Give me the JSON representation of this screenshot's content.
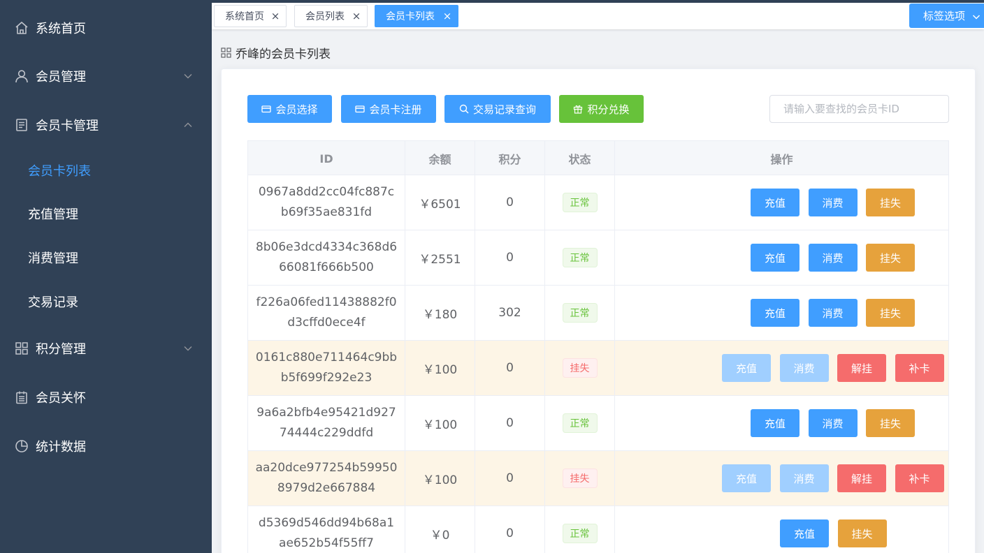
{
  "sidebar": {
    "items": [
      {
        "label": "系统首页",
        "icon": "home-icon"
      },
      {
        "label": "会员管理",
        "icon": "user-icon"
      },
      {
        "label": "会员卡管理",
        "icon": "document-icon"
      },
      {
        "label": "积分管理",
        "icon": "grid-icon"
      },
      {
        "label": "会员关怀",
        "icon": "calendar-icon"
      },
      {
        "label": "统计数据",
        "icon": "pie-chart-icon"
      }
    ],
    "submenu": [
      {
        "label": "会员卡列表",
        "active": true
      },
      {
        "label": "充值管理"
      },
      {
        "label": "消费管理"
      },
      {
        "label": "交易记录"
      }
    ]
  },
  "tags": [
    {
      "label": "系统首页"
    },
    {
      "label": "会员列表"
    },
    {
      "label": "会员卡列表",
      "active": true
    }
  ],
  "tag_options_label": "标签选项",
  "page_title": "乔峰的会员卡列表",
  "toolbar": {
    "select_member": "会员选择",
    "register_card": "会员卡注册",
    "query_transactions": "交易记录查询",
    "points_exchange": "积分兑换",
    "search_placeholder": "请输入要查找的会员卡ID"
  },
  "table": {
    "headers": [
      "ID",
      "余额",
      "积分",
      "状态",
      "操作"
    ],
    "rows": [
      {
        "id": "0967a8dd2cc04fc887cb69f35ae831fd",
        "balance": "￥6501",
        "points": "0",
        "status": "正常",
        "actions": [
          "充值",
          "消费",
          "挂失"
        ]
      },
      {
        "id": "8b06e3dcd4334c368d666081f666b500",
        "balance": "￥2551",
        "points": "0",
        "status": "正常",
        "actions": [
          "充值",
          "消费",
          "挂失"
        ]
      },
      {
        "id": "f226a06fed11438882f0d3cffd0ece4f",
        "balance": "￥180",
        "points": "302",
        "status": "正常",
        "actions": [
          "充值",
          "消费",
          "挂失"
        ]
      },
      {
        "id": "0161c880e711464c9bbb5f699f292e23",
        "balance": "￥100",
        "points": "0",
        "status": "挂失",
        "actions": [
          "充值",
          "消费",
          "解挂",
          "补卡"
        ]
      },
      {
        "id": "9a6a2bfb4e95421d92774444c229ddfd",
        "balance": "￥100",
        "points": "0",
        "status": "正常",
        "actions": [
          "充值",
          "消费",
          "挂失"
        ]
      },
      {
        "id": "aa20dce977254b599508979d2e667884",
        "balance": "￥100",
        "points": "0",
        "status": "挂失",
        "actions": [
          "充值",
          "消费",
          "解挂",
          "补卡"
        ]
      },
      {
        "id": "d5369d546dd94b68a1ae652b54f55ff7",
        "balance": "￥0",
        "points": "0",
        "status": "正常",
        "actions": [
          "充值",
          "挂失"
        ]
      }
    ]
  },
  "colors": {
    "sidebar_bg": "#304156",
    "primary": "#409eff",
    "success": "#67c23a",
    "warning": "#e6a23c",
    "danger": "#f56c6c",
    "lost_row_bg": "#fdf5e6"
  }
}
